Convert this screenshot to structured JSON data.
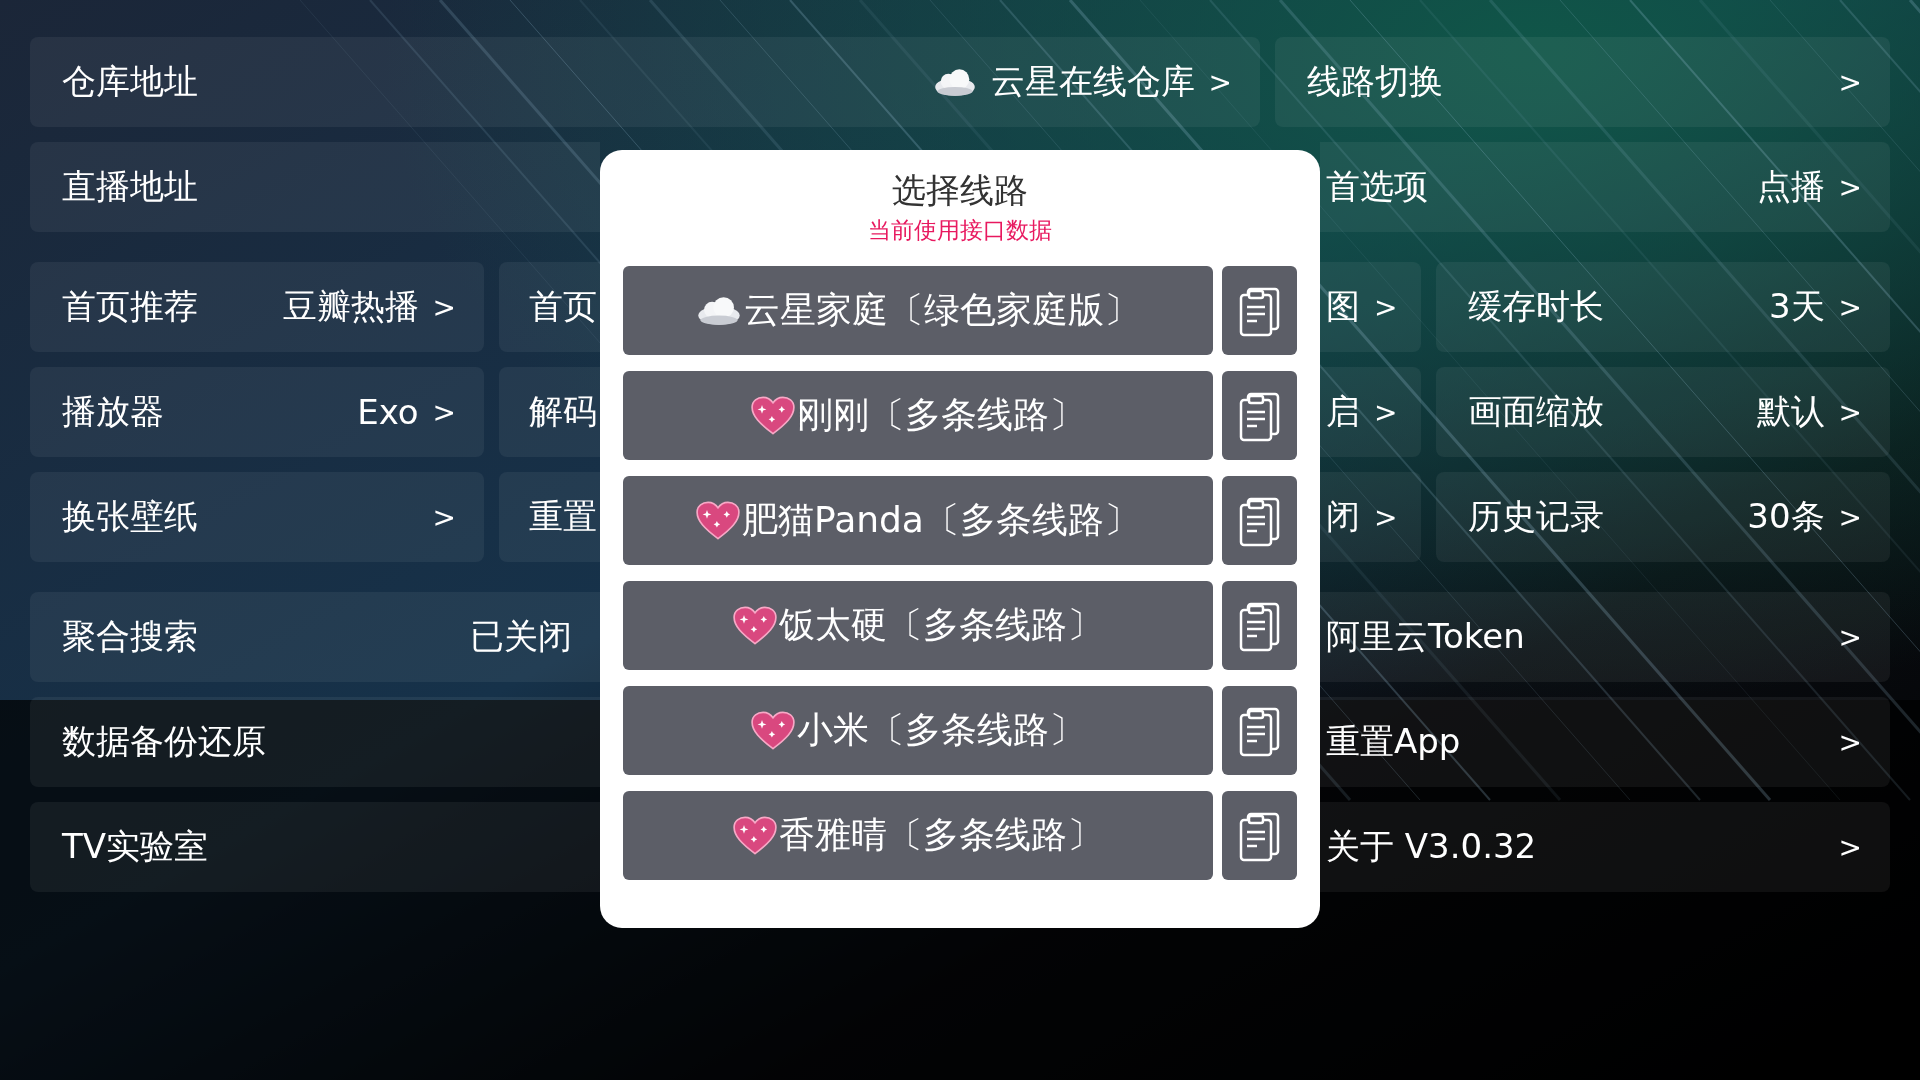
{
  "settings": [
    {
      "kind": "wide_left",
      "cells": [
        {
          "label": "仓库地址",
          "value": "云星在线仓库",
          "kind": "cloud",
          "arrow": ">"
        },
        {
          "label": "线路切换",
          "arrow": ">"
        }
      ]
    },
    {
      "kind": "wide_left",
      "cells": [
        {
          "label": "直播地址"
        },
        {
          "label": "首选项",
          "value": "点播",
          "arrow": ">"
        }
      ]
    },
    {
      "kind": "quad",
      "cells": [
        {
          "label": "首页推荐",
          "value": "豆瓣热播",
          "arrow": ">"
        },
        {
          "label": "首页"
        },
        {
          "value": "图",
          "arrow": ">"
        },
        {
          "label": "缓存时长",
          "value": "3天",
          "arrow": ">"
        }
      ]
    },
    {
      "kind": "quad",
      "cells": [
        {
          "label": "播放器",
          "value": "Exo",
          "arrow": ">"
        },
        {
          "label": "解码"
        },
        {
          "value": "启",
          "arrow": ">"
        },
        {
          "label": "画面缩放",
          "value": "默认",
          "arrow": ">"
        }
      ]
    },
    {
      "kind": "quad",
      "cells": [
        {
          "label": "换张壁纸",
          "arrow": ">"
        },
        {
          "label": "重置"
        },
        {
          "value": "闭",
          "arrow": ">"
        },
        {
          "label": "历史记录",
          "value": "30条",
          "arrow": ">"
        }
      ]
    },
    {
      "kind": "wide_right",
      "cells": [
        {
          "label": "聚合搜索",
          "value": "已关闭"
        },
        {
          "label": "阿里云Token",
          "arrow": ">"
        }
      ]
    },
    {
      "kind": "wide_right",
      "cells": [
        {
          "label": "数据备份还原"
        },
        {
          "label": "重置App",
          "arrow": ">"
        }
      ]
    },
    {
      "kind": "wide_right",
      "cells": [
        {
          "label": "TV实验室"
        },
        {
          "label": "关于  V3.0.32",
          "arrow": ">"
        }
      ]
    }
  ],
  "dialog": {
    "title": "选择线路",
    "subtitle": "当前使用接口数据",
    "options": [
      {
        "kind": "cloud",
        "label": "云星家庭〔绿色家庭版〕"
      },
      {
        "kind": "heart",
        "label": "刚刚〔多条线路〕"
      },
      {
        "kind": "heart",
        "label": "肥猫Panda〔多条线路〕"
      },
      {
        "kind": "heart",
        "label": "饭太硬〔多条线路〕"
      },
      {
        "kind": "heart",
        "label": "小米〔多条线路〕"
      },
      {
        "kind": "heart",
        "label": "香雅晴〔多条线路〕"
      }
    ]
  }
}
